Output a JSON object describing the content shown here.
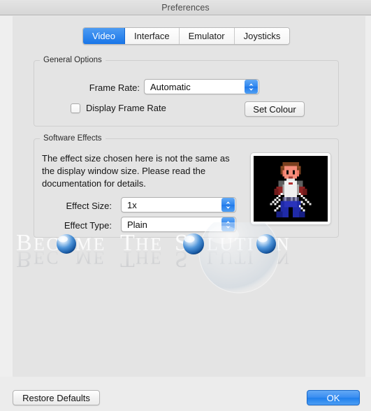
{
  "window": {
    "title": "Preferences"
  },
  "tabs": [
    {
      "label": "Video",
      "active": true
    },
    {
      "label": "Interface",
      "active": false
    },
    {
      "label": "Emulator",
      "active": false
    },
    {
      "label": "Joysticks",
      "active": false
    }
  ],
  "general_options": {
    "group_label": "General Options",
    "frame_rate": {
      "label": "Frame Rate:",
      "value": "Automatic",
      "stepper_icon": "chevron-up-down-icon"
    },
    "display_frame_rate": {
      "label": "Display Frame Rate",
      "checked": false
    },
    "set_colour_button": "Set Colour"
  },
  "software_effects": {
    "group_label": "Software Effects",
    "description": "The effect size chosen here is not the same as the display window size. Please read the documentation for details.",
    "effect_size": {
      "label": "Effect Size:",
      "value": "1x",
      "stepper_icon": "chevron-up-down-icon"
    },
    "effect_type": {
      "label": "Effect Type:",
      "value": "Plain",
      "stepper_icon": "chevron-up-down-icon"
    },
    "preview": {
      "name": "sprite-preview",
      "alt": "pixel-art sprite character with two swords"
    }
  },
  "footer": {
    "restore_defaults": "Restore Defaults",
    "ok": "OK"
  },
  "watermark": {
    "text": "BECOME THE SOLUTION"
  },
  "colors": {
    "accent_blue": "#2080ec",
    "tab_active_blue": "#1775e8",
    "window_bg": "#e4e4e4",
    "titlebar_bg": "#d6d6d6",
    "text": "#141414"
  }
}
